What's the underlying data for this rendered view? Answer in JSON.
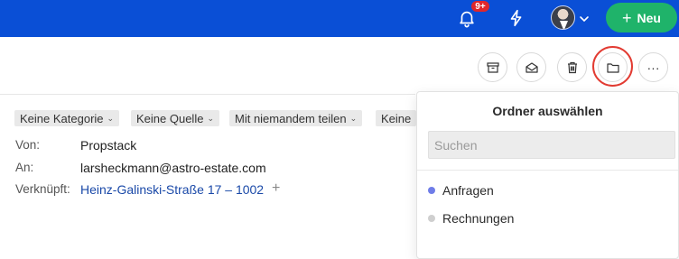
{
  "topbar": {
    "notifications_badge": "9+",
    "new_button_label": "Neu",
    "colors": {
      "background": "#0a4fd6",
      "new_button": "#1fb36a",
      "badge": "#e0262b"
    },
    "icons": [
      "bell-icon",
      "bolt-icon",
      "avatar",
      "chevron-down-icon",
      "plus-icon"
    ]
  },
  "toolbar": {
    "buttons": [
      "archive-icon",
      "mark-read-icon",
      "trash-icon",
      "folder-icon",
      "more-icon"
    ],
    "more_label": "···",
    "active": "folder-icon",
    "highlight_color": "#e23b32"
  },
  "tags": [
    {
      "label": "Keine Kategorie"
    },
    {
      "label": "Keine Quelle"
    },
    {
      "label": "Mit niemandem teilen"
    },
    {
      "label": "Keine"
    }
  ],
  "meta": {
    "from_label": "Von:",
    "from_value": "Propstack",
    "to_label": "An:",
    "to_value": "larsheckmann@astro-estate.com",
    "linked_label": "Verknüpft:",
    "linked_value": "Heinz-Galinski-Straße 17 – 1002",
    "add_label": "+"
  },
  "folder_picker": {
    "title": "Ordner auswählen",
    "search_placeholder": "Suchen",
    "search_value": "",
    "folders": [
      {
        "label": "Anfragen",
        "color": "#6f7de8"
      },
      {
        "label": "Rechnungen",
        "color": "#cfcfcf"
      }
    ]
  }
}
